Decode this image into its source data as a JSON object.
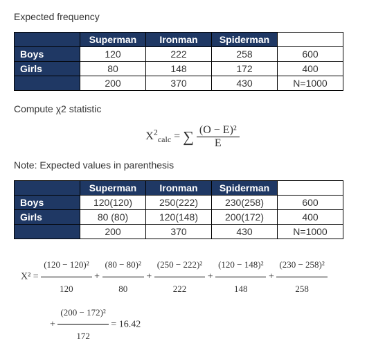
{
  "section1_title": "Expected frequency",
  "columns": {
    "c1": "Superman",
    "c2": "Ironman",
    "c3": "Spiderman"
  },
  "rows": {
    "r1": "Boys",
    "r2": "Girls"
  },
  "table1": {
    "r1c1": "120",
    "r1c2": "222",
    "r1c3": "258",
    "r1tot": "600",
    "r2c1": "80",
    "r2c2": "148",
    "r2c3": "172",
    "r2tot": "400",
    "tc1": "200",
    "tc2": "370",
    "tc3": "430",
    "N": "N=1000"
  },
  "section2_title": "Compute χ2 statistic",
  "formula": {
    "lhs_base": "X",
    "lhs_sup": "2",
    "lhs_sub": "calc",
    "eq": " = ",
    "sum": "∑",
    "num": "(O − E)²",
    "den": "E"
  },
  "section3_title": "Note: Expected values in parenthesis",
  "table2": {
    "r1c1": "120(120)",
    "r1c2": "250(222)",
    "r1c3": "230(258)",
    "r1tot": "600",
    "r2c1": "80 (80)",
    "r2c2": "120(148)",
    "r2c3": "200(172)",
    "r2tot": "400",
    "tc1": "200",
    "tc2": "370",
    "tc3": "430",
    "N": "N=1000"
  },
  "calc": {
    "lhs": "X² = ",
    "t1n": "(120 − 120)²",
    "t1d": "120",
    "t2n": "(80 − 80)²",
    "t2d": "80",
    "t3n": "(250 − 222)²",
    "t3d": "222",
    "t4n": "(120 − 148)²",
    "t4d": "148",
    "t5n": "(230 − 258)²",
    "t5d": "258",
    "t6n": "(200 − 172)²",
    "t6d": "172",
    "plus": " + ",
    "result": " = 16.42"
  }
}
